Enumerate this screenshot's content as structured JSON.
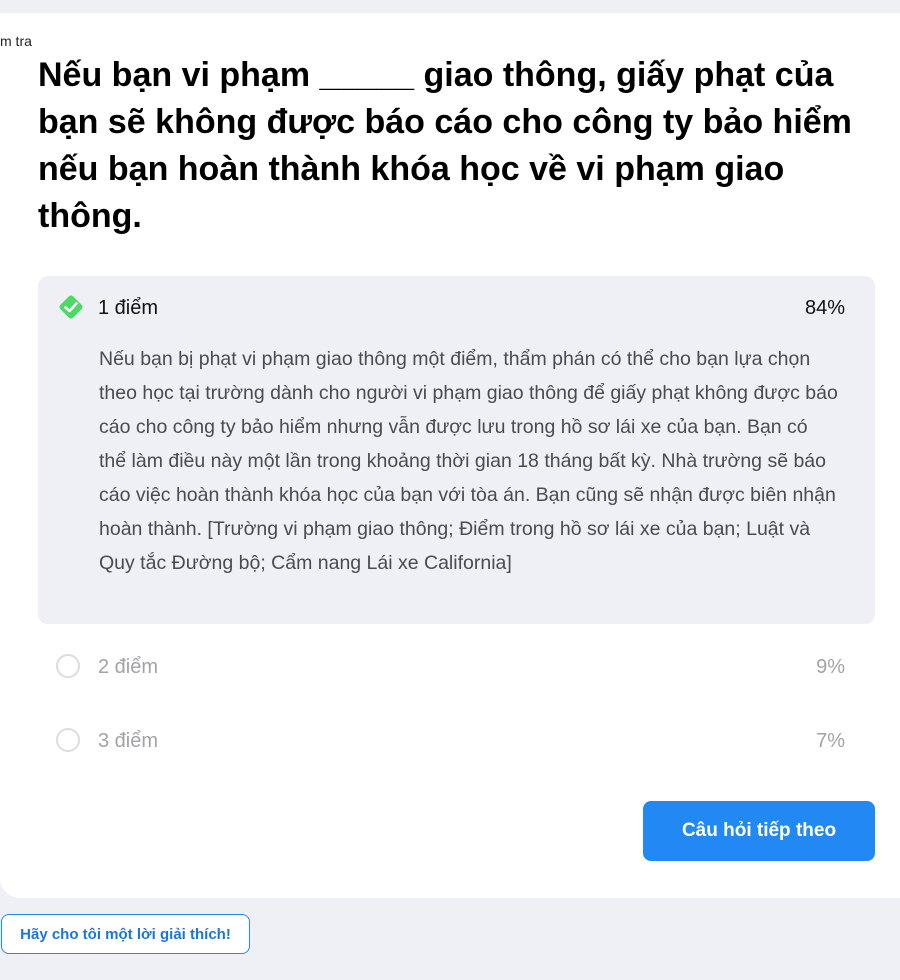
{
  "breadcrumb": "m tra",
  "question": "Nếu bạn vi phạm _____ giao thông, giấy phạt của bạn sẽ không được báo cáo cho công ty bảo hiểm nếu bạn hoàn thành khóa học về vi phạm giao thông.",
  "options": [
    {
      "label": "1 điểm",
      "percent": "84%",
      "correct": true,
      "explanation": "Nếu bạn bị phạt vi phạm giao thông một điểm, thẩm phán có thể cho bạn lựa chọn theo học tại trường dành cho người vi phạm giao thông để giấy phạt không được báo cáo cho công ty bảo hiểm nhưng vẫn được lưu trong hồ sơ lái xe của bạn. Bạn có thể làm điều này một lần trong khoảng thời gian 18 tháng bất kỳ. Nhà trường sẽ báo cáo việc hoàn thành khóa học của bạn với tòa án. Bạn cũng sẽ nhận được biên nhận hoàn thành. [Trường vi phạm giao thông; Điểm trong hồ sơ lái xe của bạn; Luật và Quy tắc Đường bộ; Cẩm nang Lái xe California]"
    },
    {
      "label": "2 điểm",
      "percent": "9%",
      "correct": false
    },
    {
      "label": "3 điểm",
      "percent": "7%",
      "correct": false
    }
  ],
  "next_button": "Câu hỏi tiếp theo",
  "explain_button": "Hãy cho tôi một lời giải thích!",
  "colors": {
    "accent": "#2288f3",
    "correct": "#4cd964",
    "background": "#eff0f5"
  }
}
